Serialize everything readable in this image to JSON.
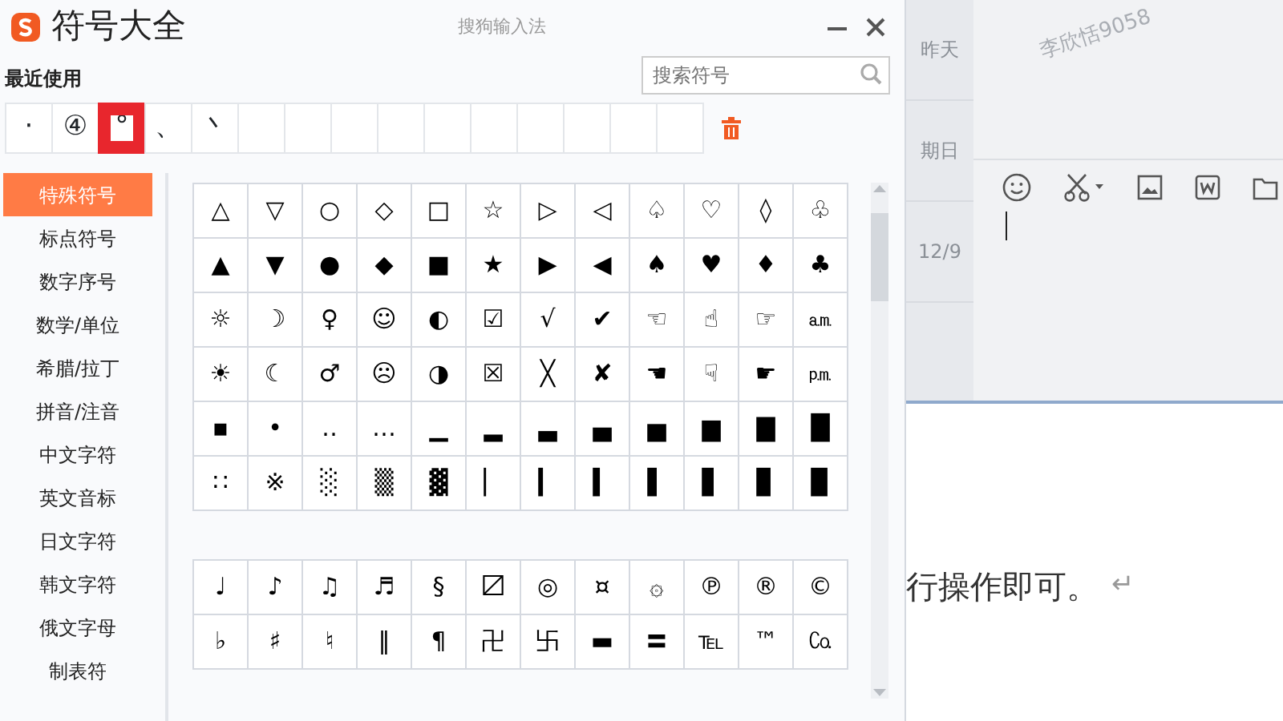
{
  "window": {
    "title": "符号大全",
    "app_name": "搜狗输入法"
  },
  "recent": {
    "label": "最近使用",
    "items": [
      {
        "symbol": "·",
        "highlighted": false
      },
      {
        "symbol": "④",
        "highlighted": false
      },
      {
        "symbol": "°",
        "highlighted": true
      },
      {
        "symbol": "、",
        "highlighted": false
      },
      {
        "symbol": "丶",
        "highlighted": false
      }
    ]
  },
  "search": {
    "placeholder": "搜索符号"
  },
  "categories": [
    {
      "label": "特殊符号",
      "selected": true
    },
    {
      "label": "标点符号",
      "selected": false
    },
    {
      "label": "数字序号",
      "selected": false
    },
    {
      "label": "数学/单位",
      "selected": false
    },
    {
      "label": "希腊/拉丁",
      "selected": false
    },
    {
      "label": "拼音/注音",
      "selected": false
    },
    {
      "label": "中文字符",
      "selected": false
    },
    {
      "label": "英文音标",
      "selected": false
    },
    {
      "label": "日文字符",
      "selected": false
    },
    {
      "label": "韩文字符",
      "selected": false
    },
    {
      "label": "俄文字母",
      "selected": false
    },
    {
      "label": "制表符",
      "selected": false
    }
  ],
  "symbol_groups": [
    [
      [
        "△",
        "▽",
        "○",
        "◇",
        "□",
        "☆",
        "▷",
        "◁",
        "♤",
        "♡",
        "◊",
        "♧"
      ],
      [
        "▲",
        "▼",
        "●",
        "◆",
        "■",
        "★",
        "▶",
        "◀",
        "♠",
        "♥",
        "♦",
        "♣"
      ],
      [
        "☼",
        "☽",
        "♀",
        "☺",
        "◐",
        "☑",
        "√",
        "✔",
        "☜",
        "☝",
        "☞",
        "㏂"
      ],
      [
        "☀",
        "☾",
        "♂",
        "☹",
        "◑",
        "☒",
        "╳",
        "✘",
        "☚",
        "☟",
        "☛",
        "㏘"
      ],
      [
        "▪",
        "•",
        "‥",
        "…",
        "▁",
        "▂",
        "▃",
        "▄",
        "▅",
        "▆",
        "▇",
        "█"
      ],
      [
        "∷",
        "※",
        "░",
        "▒",
        "▓",
        "▏",
        "▎",
        "▍",
        "▌",
        "▋",
        "▊",
        "▉"
      ]
    ],
    [
      [
        "♩",
        "♪",
        "♫",
        "♬",
        "§",
        "〼",
        "◎",
        "¤",
        "۞",
        "℗",
        "®",
        "©"
      ],
      [
        "♭",
        "♯",
        "♮",
        "‖",
        "¶",
        "卍",
        "卐",
        "▬",
        "〓",
        "℡",
        "™",
        "㏇"
      ]
    ]
  ],
  "chat": {
    "times": [
      "昨天",
      "期日",
      "12/9"
    ],
    "watermark": "李欣恬9058"
  },
  "document": {
    "text": "行操作即可。",
    "mark": "↵"
  }
}
